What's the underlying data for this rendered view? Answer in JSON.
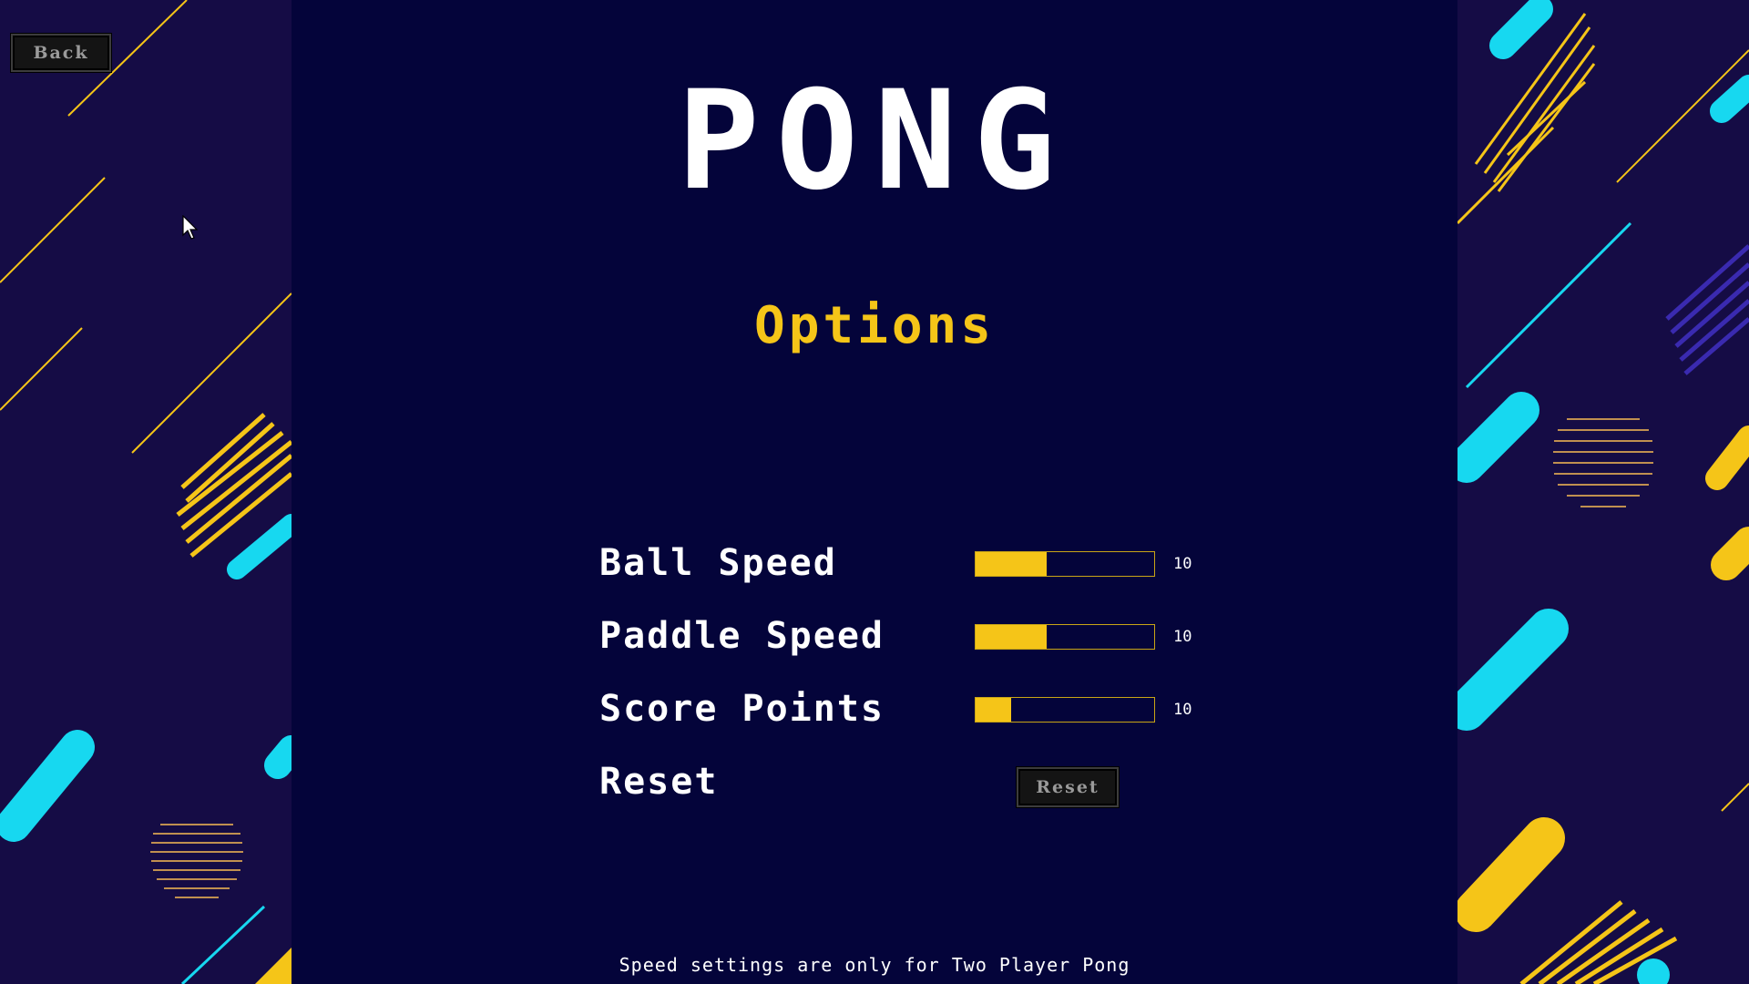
{
  "app": {
    "title": "PONG",
    "subtitle": "Options"
  },
  "nav": {
    "back_label": "Back"
  },
  "options": {
    "ball_speed": {
      "label": "Ball Speed",
      "value": "10",
      "fill_fraction": 0.4
    },
    "paddle_speed": {
      "label": "Paddle Speed",
      "value": "10",
      "fill_fraction": 0.4
    },
    "score_points": {
      "label": "Score Points",
      "value": "10",
      "fill_fraction": 0.2
    },
    "reset": {
      "label": "Reset",
      "button_label": "Reset"
    }
  },
  "footer": {
    "note": "Speed settings are only for Two Player Pong"
  },
  "colors": {
    "background": "#04043a",
    "side_background": "#150c45",
    "accent_yellow": "#f5c518",
    "accent_cyan": "#17d8f0",
    "accent_purple": "#3a2ab0"
  },
  "icons": {
    "cursor": "mouse-pointer-icon"
  }
}
